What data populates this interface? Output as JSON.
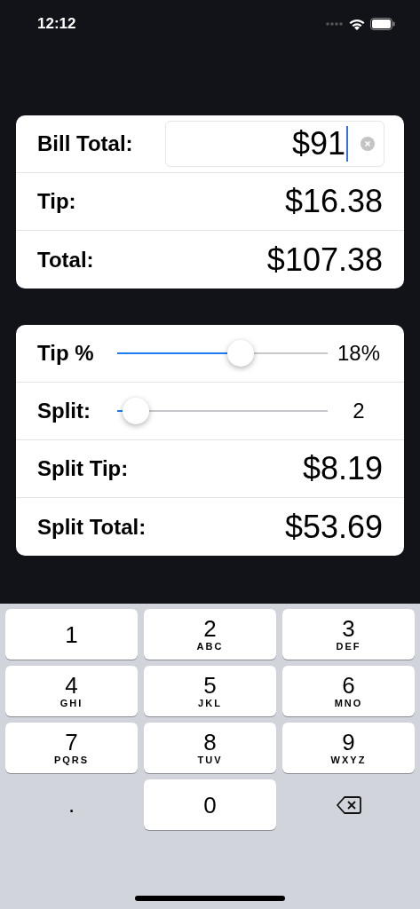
{
  "status_bar": {
    "time": "12:12"
  },
  "bill_card": {
    "bill_label": "Bill Total:",
    "bill_value": "$91",
    "rows": [
      {
        "label": "Tip:",
        "value": "$16.38"
      },
      {
        "label": "Total:",
        "value": "$107.38"
      }
    ]
  },
  "split_card": {
    "sliders": [
      {
        "label": "Tip %",
        "level": 0.585,
        "reading": "18%"
      },
      {
        "label": "Split:",
        "level": 0.09,
        "reading": "2"
      }
    ],
    "rows": [
      {
        "label": "Split Tip:",
        "value": "$8.19"
      },
      {
        "label": "Split Total:",
        "value": "$53.69"
      }
    ]
  },
  "keypad": [
    {
      "kind": "digit",
      "digit": "1"
    },
    {
      "kind": "digit",
      "digit": "2",
      "letters": "ABC"
    },
    {
      "kind": "digit",
      "digit": "3",
      "letters": "DEF"
    },
    {
      "kind": "digit",
      "digit": "4",
      "letters": "GHI"
    },
    {
      "kind": "digit",
      "digit": "5",
      "letters": "JKL"
    },
    {
      "kind": "digit",
      "digit": "6",
      "letters": "MNO"
    },
    {
      "kind": "digit",
      "digit": "7",
      "letters": "PQRS"
    },
    {
      "kind": "digit",
      "digit": "8",
      "letters": "TUV"
    },
    {
      "kind": "digit",
      "digit": "9",
      "letters": "WXYZ"
    },
    {
      "kind": "plain",
      "digit": "."
    },
    {
      "kind": "digit",
      "digit": "0"
    },
    {
      "kind": "delete"
    }
  ]
}
